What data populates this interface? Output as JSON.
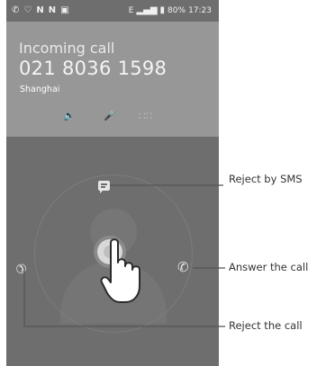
{
  "status_bar": {
    "left_icons": [
      "phone-icon",
      "heart-icon",
      "n-icon",
      "n-icon",
      "image-icon"
    ],
    "network": "E",
    "battery": "80%",
    "time": "17:23"
  },
  "call": {
    "title": "Incoming call",
    "number": "021 8036 1598",
    "location": "Shanghai"
  },
  "actions": [
    "speaker-icon",
    "mute-icon",
    "dialpad-icon"
  ],
  "labels": {
    "sms": "Reject by SMS",
    "answer": "Answer the call",
    "reject": "Reject the call"
  }
}
